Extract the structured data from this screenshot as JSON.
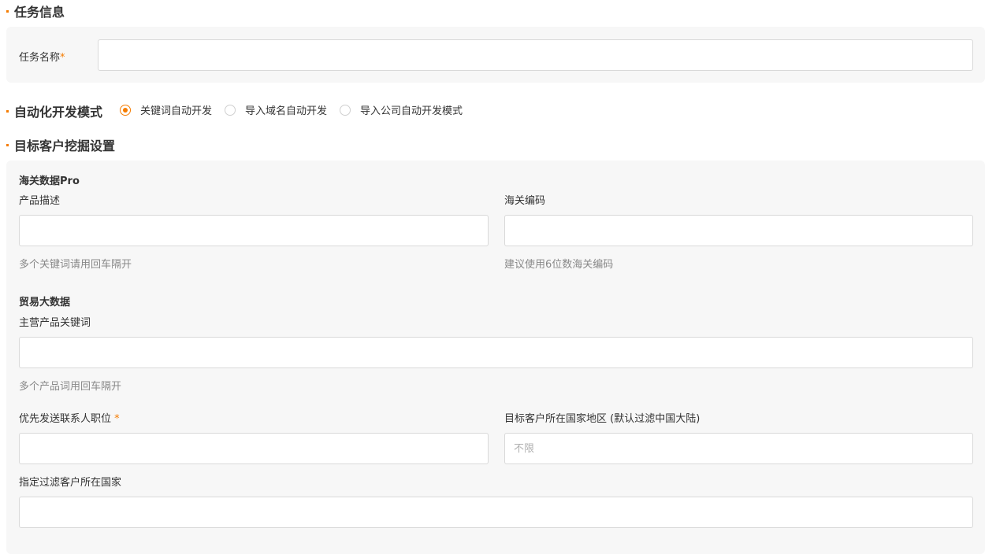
{
  "sections": {
    "task_info": "任务信息",
    "auto_mode": "自动化开发模式",
    "target_settings": "目标客户挖掘设置"
  },
  "task_info": {
    "name_label": "任务名称",
    "required_mark": "*",
    "name_value": ""
  },
  "auto_mode": {
    "options": [
      {
        "label": "关键词自动开发",
        "checked": true
      },
      {
        "label": "导入域名自动开发",
        "checked": false
      },
      {
        "label": "导入公司自动开发模式",
        "checked": false
      }
    ]
  },
  "customs": {
    "title": "海关数据Pro",
    "product_desc_label": "产品描述",
    "product_desc_value": "",
    "product_desc_hint": "多个关键词请用回车隔开",
    "hs_code_label": "海关编码",
    "hs_code_value": "",
    "hs_code_hint": "建议使用6位数海关编码"
  },
  "trade": {
    "title": "贸易大数据",
    "keywords_label": "主营产品关键词",
    "keywords_value": "",
    "keywords_hint": "多个产品词用回车隔开",
    "position_label": "优先发送联系人职位",
    "required_mark": "*",
    "position_value": "",
    "country_label": "目标客户所在国家地区 (默认过滤中国大陆)",
    "country_placeholder": "不限",
    "filter_country_label": "指定过滤客户所在国家",
    "filter_country_value": ""
  },
  "colors": {
    "accent": "#f57c00",
    "panel_bg": "#f7f7f7",
    "border": "#d9d9d9"
  }
}
